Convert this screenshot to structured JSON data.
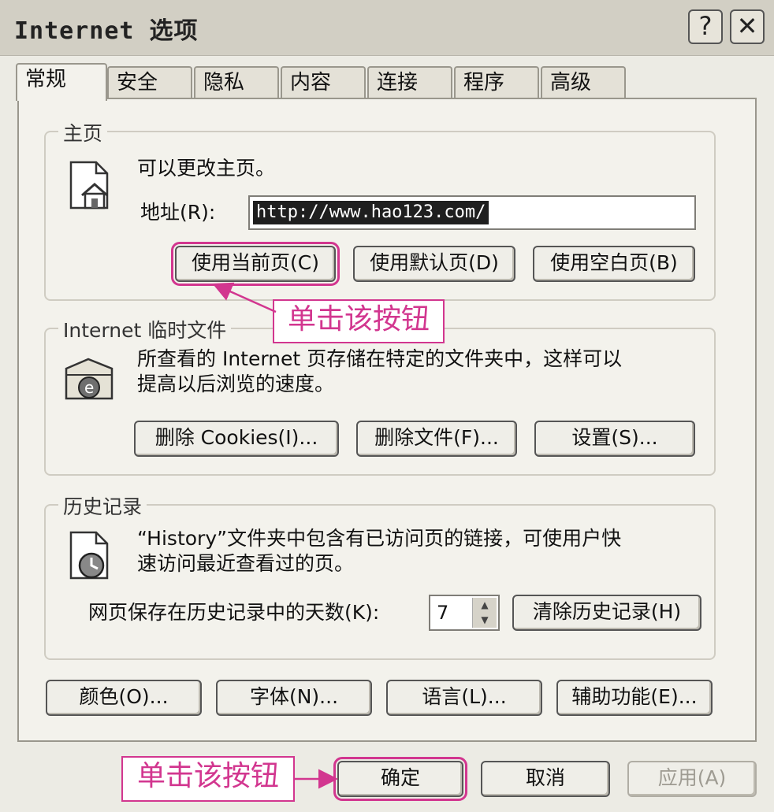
{
  "window": {
    "title": "Internet 选项",
    "help": "?",
    "close": "✕"
  },
  "tabs": [
    "常规",
    "安全",
    "隐私",
    "内容",
    "连接",
    "程序",
    "高级"
  ],
  "homepage": {
    "group_label": "主页",
    "desc": "可以更改主页。",
    "address_label": "地址(R):",
    "address_value": "http://www.hao123.com/",
    "buttons": [
      "使用当前页(C)",
      "使用默认页(D)",
      "使用空白页(B)"
    ]
  },
  "temp_files": {
    "group_label": "Internet 临时文件",
    "desc_line1": "所查看的 Internet 页存储在特定的文件夹中，这样可以",
    "desc_line2": "提高以后浏览的速度。",
    "buttons": [
      "删除 Cookies(I)...",
      "删除文件(F)...",
      "设置(S)..."
    ]
  },
  "history": {
    "group_label": "历史记录",
    "desc_line1": "“History”文件夹中包含有已访问页的链接，可使用户快",
    "desc_line2": "速访问最近查看过的页。",
    "days_label": "网页保存在历史记录中的天数(K):",
    "days_value": "7",
    "clear_button": "清除历史记录(H)"
  },
  "bottom_buttons": [
    "颜色(O)...",
    "字体(N)...",
    "语言(L)...",
    "辅助功能(E)..."
  ],
  "dialog_buttons": {
    "ok": "确定",
    "cancel": "取消",
    "apply": "应用(A)"
  },
  "annotations": {
    "top_callout": "单击该按钮",
    "bottom_callout": "单击该按钮"
  },
  "colors": {
    "annotation": "#d2368f"
  }
}
